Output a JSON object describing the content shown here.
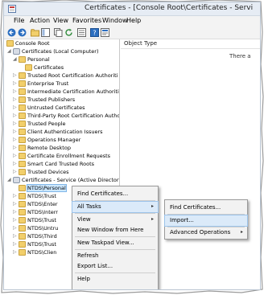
{
  "window": {
    "title": "Certificates - [Console Root\\Certificates - Servi"
  },
  "menu": [
    "File",
    "Action",
    "View",
    "Favorites",
    "Window",
    "Help"
  ],
  "list": {
    "column_header": "Object Type",
    "empty_message": "There a"
  },
  "tree": [
    {
      "label": "Console Root"
    },
    {
      "label": "Certificates (Local Computer)"
    },
    {
      "label": "Personal"
    },
    {
      "label": "Certificates"
    },
    {
      "label": "Trusted Root Certification Authoriti"
    },
    {
      "label": "Enterprise Trust"
    },
    {
      "label": "Intermediate Certification Authoriti"
    },
    {
      "label": "Trusted Publishers"
    },
    {
      "label": "Untrusted Certificates"
    },
    {
      "label": "Third-Party Root Certification Autho"
    },
    {
      "label": "Trusted People"
    },
    {
      "label": "Client Authentication Issuers"
    },
    {
      "label": "Operations Manager"
    },
    {
      "label": "Remote Desktop"
    },
    {
      "label": "Certificate Enrollment Requests"
    },
    {
      "label": "Smart Card Trusted Roots"
    },
    {
      "label": "Trusted Devices"
    },
    {
      "label": "Certificates - Service (Active Directory D"
    },
    {
      "label": "NTDS\\Personal"
    },
    {
      "label": "NTDS\\Trust"
    },
    {
      "label": "NTDS\\Enter"
    },
    {
      "label": "NTDS\\Interr"
    },
    {
      "label": "NTDS\\Trust"
    },
    {
      "label": "NTDS\\Untru"
    },
    {
      "label": "NTDS\\Third"
    },
    {
      "label": "NTDS\\Trust"
    },
    {
      "label": "NTDS\\Clien"
    }
  ],
  "context_menu": {
    "items": [
      "Find Certificates...",
      "All Tasks",
      "View",
      "New Window from Here",
      "New Taskpad View...",
      "Refresh",
      "Export List...",
      "Help"
    ],
    "submenu_arrow": "▸"
  },
  "submenu": {
    "items": [
      "Find Certificates...",
      "Import...",
      "Advanced Operations"
    ],
    "submenu_arrow": "▸"
  },
  "colors": {
    "selection": "#cde8ff",
    "highlight": "#dbeaf9",
    "folder": "#f2cf6b"
  }
}
